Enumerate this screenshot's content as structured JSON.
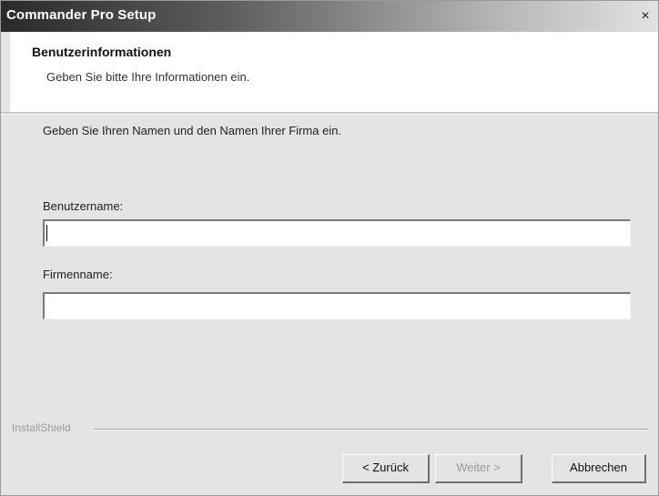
{
  "window": {
    "title": "Commander Pro Setup",
    "close_glyph": "×"
  },
  "header": {
    "title": "Benutzerinformationen",
    "subtitle": "Geben Sie bitte Ihre Informationen ein."
  },
  "content": {
    "instruction": "Geben Sie Ihren Namen und den Namen Ihrer Firma ein.",
    "user_label": "Benutzername:",
    "user_value": "",
    "company_label": "Firmenname:",
    "company_value": ""
  },
  "footer": {
    "brand": "InstallShield",
    "back_label": "< Zurück",
    "next_label": "Weiter >",
    "next_enabled": false,
    "cancel_label": "Abbrechen"
  }
}
